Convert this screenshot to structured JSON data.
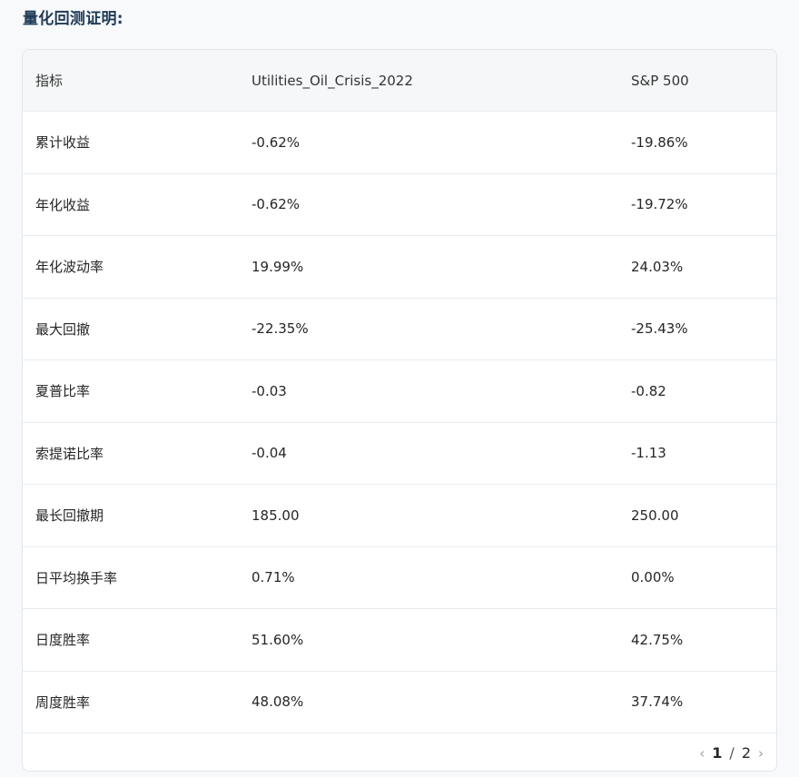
{
  "title": "量化回测证明:",
  "table": {
    "headers": [
      "指标",
      "Utilities_Oil_Crisis_2022",
      "S&P 500"
    ],
    "rows": [
      [
        "累计收益",
        "-0.62%",
        "-19.86%"
      ],
      [
        "年化收益",
        "-0.62%",
        "-19.72%"
      ],
      [
        "年化波动率",
        "19.99%",
        "24.03%"
      ],
      [
        "最大回撤",
        "-22.35%",
        "-25.43%"
      ],
      [
        "夏普比率",
        "-0.03",
        "-0.82"
      ],
      [
        "索提诺比率",
        "-0.04",
        "-1.13"
      ],
      [
        "最长回撤期",
        "185.00",
        "250.00"
      ],
      [
        "日平均换手率",
        "0.71%",
        "0.00%"
      ],
      [
        "日度胜率",
        "51.60%",
        "42.75%"
      ],
      [
        "周度胜率",
        "48.08%",
        "37.74%"
      ]
    ]
  },
  "pagination": {
    "current": "1",
    "separator": "/",
    "total": "2",
    "prev_icon": "‹",
    "next_icon": "›"
  }
}
